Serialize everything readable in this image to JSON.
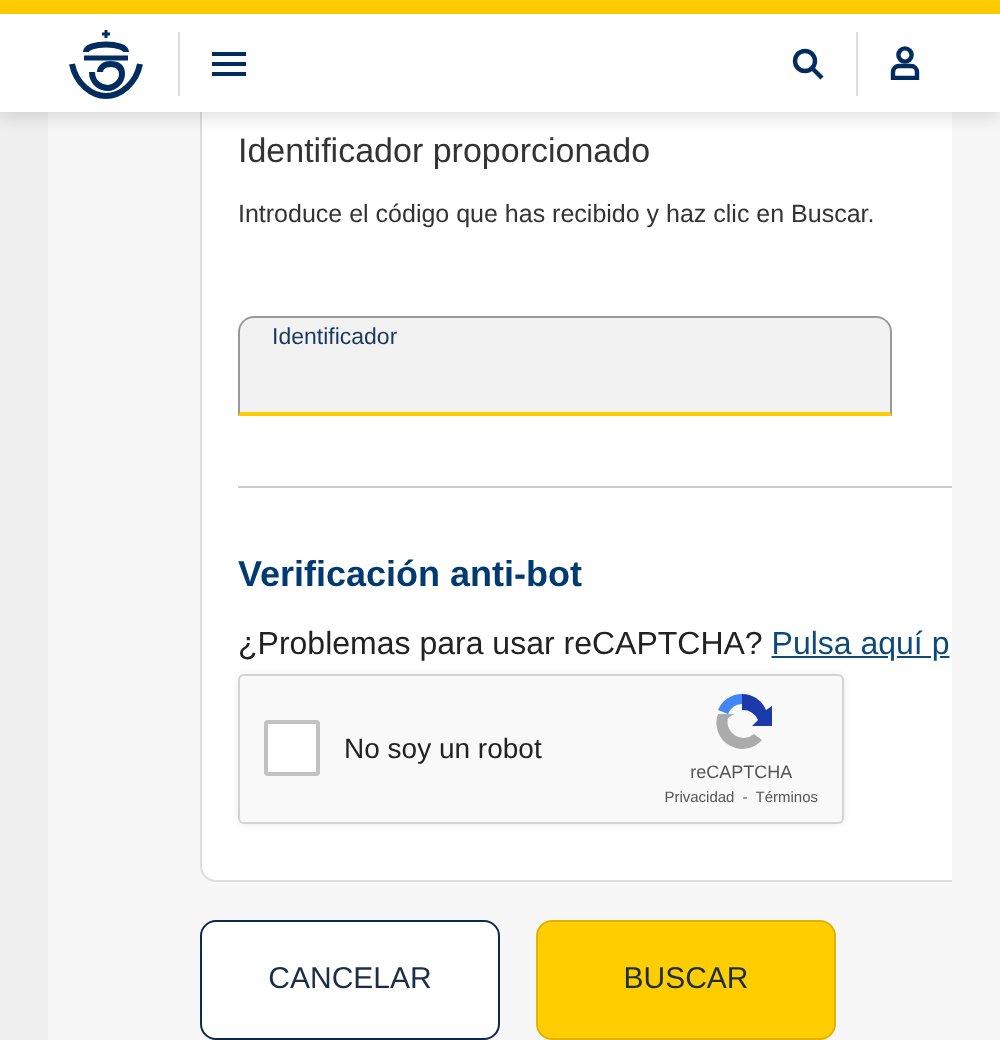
{
  "identifier": {
    "title": "Identificador proporcionado",
    "description": "Introduce el código que has recibido y haz clic en Buscar.",
    "field": {
      "label": "Identificador"
    }
  },
  "antibot": {
    "title": "Verificación anti-bot",
    "help_text": "¿Problemas para usar reCAPTCHA?",
    "help_link": "Pulsa aquí p",
    "captcha": {
      "label": "No soy un robot",
      "checked": false,
      "brand": "reCAPTCHA",
      "privacy": "Privacidad",
      "separator": "-",
      "terms": "Términos"
    }
  },
  "buttons": [
    {
      "label": "CANCELAR",
      "kind": "secondary"
    },
    {
      "label": "BUSCAR",
      "kind": "primary"
    }
  ]
}
